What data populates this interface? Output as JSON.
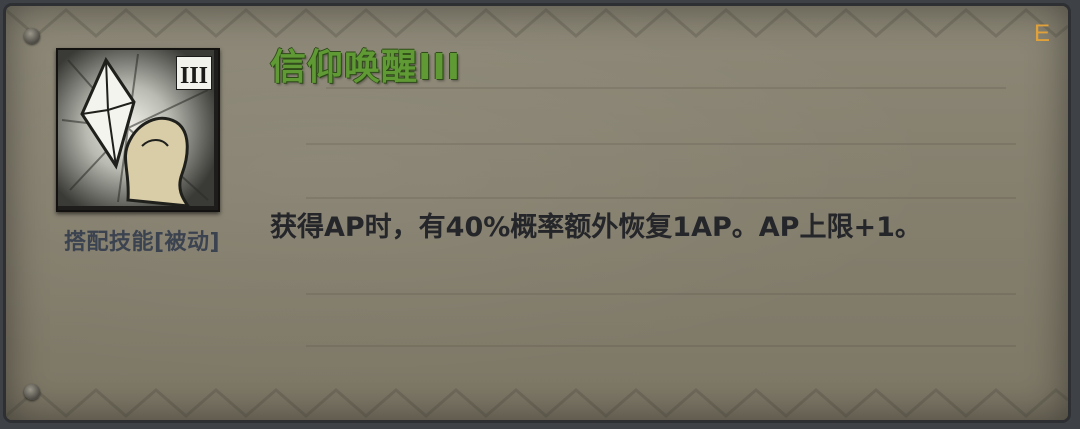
{
  "skill": {
    "title": "信仰唤醒III",
    "tier_badge": "III",
    "type_label": "搭配技能[被动]",
    "hotkey": "E",
    "description": "获得AP时，有40%概率额外恢复1AP。AP上限+1。"
  },
  "icons": {
    "skill_icon": "crystal-and-hand-icon"
  },
  "colors": {
    "title": "#5f9a35",
    "hotkey": "#e0a03a",
    "description": "#25262a",
    "type_label": "#3c4350",
    "panel": "#857f6e"
  }
}
